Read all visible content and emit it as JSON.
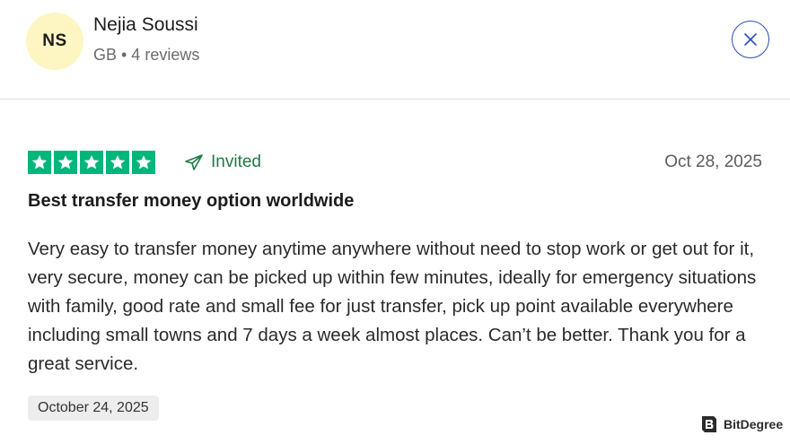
{
  "reviewer": {
    "initials": "NS",
    "name": "Nejia Soussi",
    "meta": "GB • 4 reviews"
  },
  "colors": {
    "star_green": "#00b67a",
    "invited_green": "#1e7a46",
    "close_blue": "#2a4fb8",
    "avatar_bg": "#fdf6c2"
  },
  "review": {
    "rating": 5,
    "rating_max": 5,
    "invited_label": "Invited",
    "date": "Oct 28, 2025",
    "title": "Best transfer money option worldwide",
    "body": "Very easy to transfer money anytime anywhere without need to stop work or get out for it, very secure, money can be picked up within few minutes, ideally for emergency situations with family, good rate and small fee for just transfer, pick up point available everywhere including small towns and 7 days a week almost places. Can’t be better. Thank you for a great service.",
    "experience_date": "October 24, 2025"
  },
  "watermark": {
    "text": "BitDegree"
  },
  "icons": {
    "close": "close-icon",
    "invited": "paper-plane-icon",
    "star": "star-icon"
  }
}
